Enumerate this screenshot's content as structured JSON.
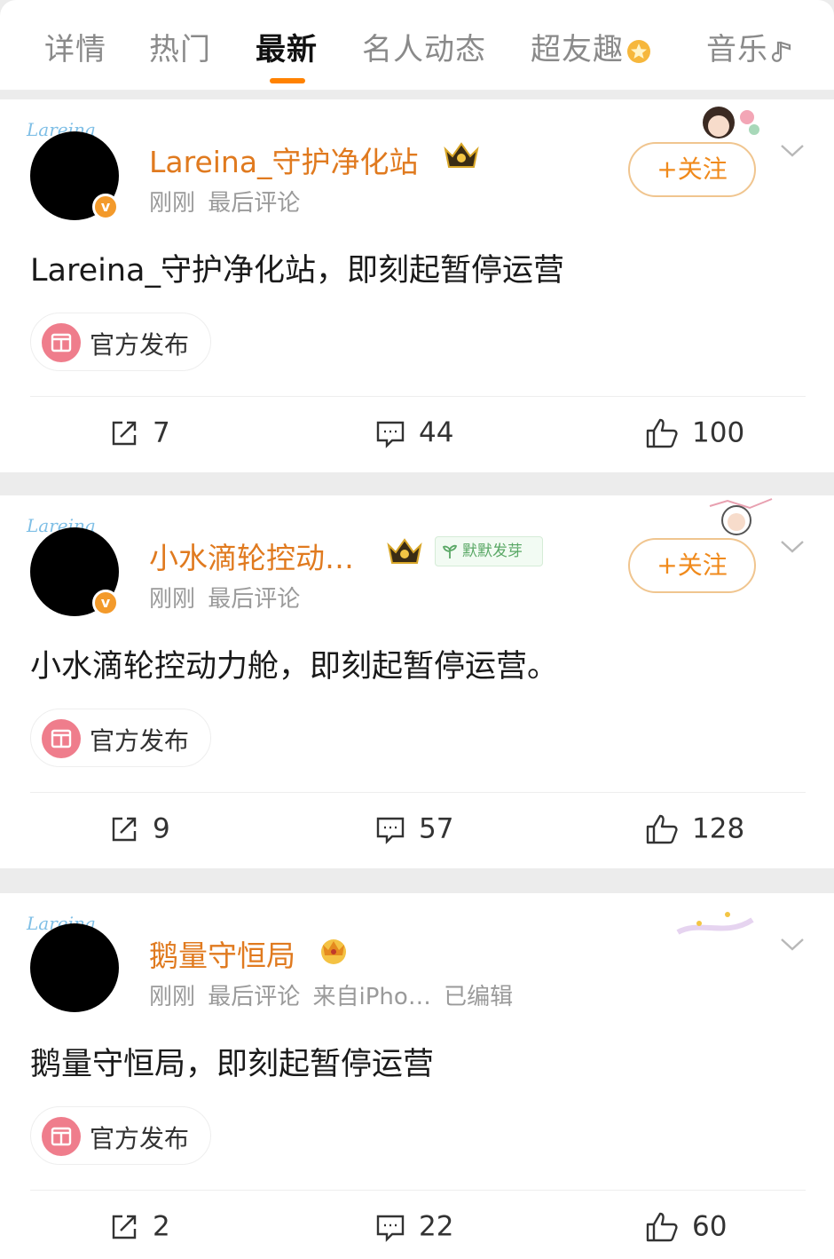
{
  "tabs": [
    {
      "label": "详情",
      "active": false
    },
    {
      "label": "热门",
      "active": false
    },
    {
      "label": "最新",
      "active": true
    },
    {
      "label": "名人动态",
      "active": false
    },
    {
      "label": "超友趣",
      "active": false,
      "icon": "star-badge-icon"
    },
    {
      "label": "音乐",
      "active": false,
      "icon": "music-note-icon"
    }
  ],
  "accent_color": "#ff8200",
  "username_color": "#e07a1f",
  "posts": [
    {
      "avatar_frame_text": "Lareina",
      "username": "Lareina_守护净化站",
      "meta": "刚刚  最后评论",
      "follow_label": "+关注",
      "text": "Lareina_守护净化站，即刻起暂停运营",
      "tag": "官方发布",
      "reposts": "7",
      "comments": "44",
      "likes": "100"
    },
    {
      "avatar_frame_text": "Lareina",
      "username": "小水滴轮控动…",
      "badge": "默默发芽",
      "meta": "刚刚  最后评论",
      "follow_label": "+关注",
      "text": "小水滴轮控动力舱，即刻起暂停运营。",
      "tag": "官方发布",
      "reposts": "9",
      "comments": "57",
      "likes": "128"
    },
    {
      "avatar_frame_text": "Lareina",
      "username": "鹅量守恒局",
      "meta": "刚刚  最后评论  来自iPho…  已编辑",
      "text": "鹅量守恒局，即刻起暂停运营",
      "tag": "官方发布",
      "reposts": "2",
      "comments": "22",
      "likes": "60"
    }
  ]
}
